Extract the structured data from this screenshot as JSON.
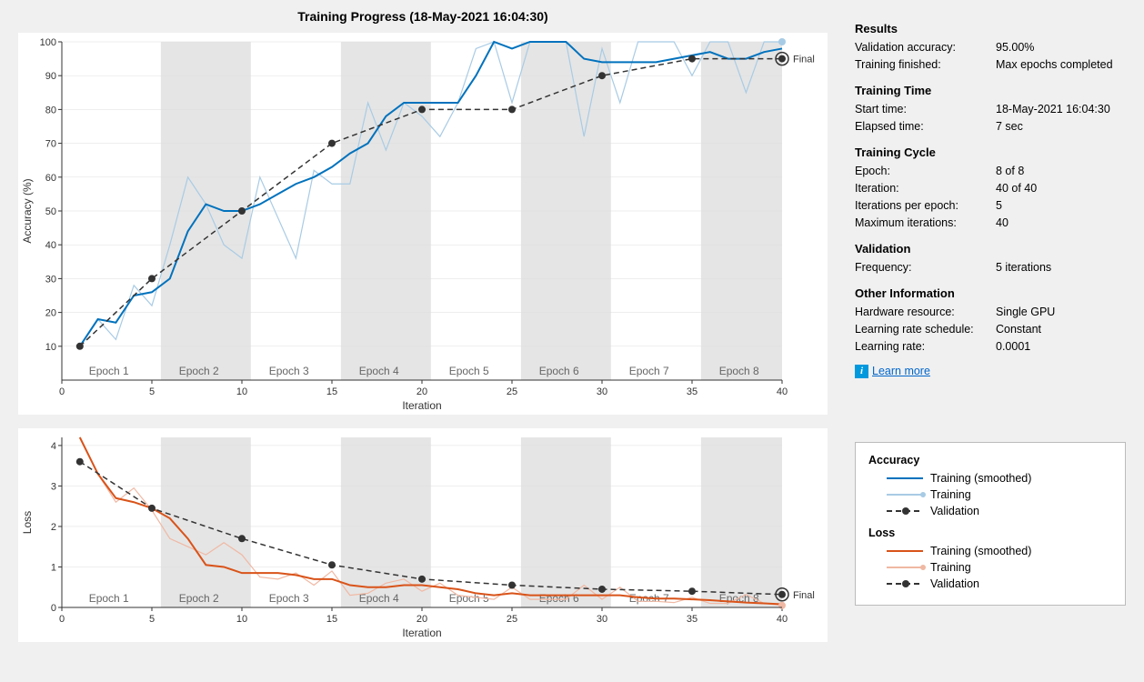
{
  "title": "Training Progress (18-May-2021 16:04:30)",
  "info": {
    "results": {
      "head": "Results",
      "valacc_l": "Validation accuracy:",
      "valacc_v": "95.00%",
      "fin_l": "Training finished:",
      "fin_v": "Max epochs completed"
    },
    "time": {
      "head": "Training Time",
      "start_l": "Start time:",
      "start_v": "18-May-2021 16:04:30",
      "elapsed_l": "Elapsed time:",
      "elapsed_v": "7 sec"
    },
    "cycle": {
      "head": "Training Cycle",
      "epoch_l": "Epoch:",
      "epoch_v": "8 of 8",
      "iter_l": "Iteration:",
      "iter_v": "40 of 40",
      "ipe_l": "Iterations per epoch:",
      "ipe_v": "5",
      "maxit_l": "Maximum iterations:",
      "maxit_v": "40"
    },
    "validation": {
      "head": "Validation",
      "freq_l": "Frequency:",
      "freq_v": "5 iterations"
    },
    "other": {
      "head": "Other Information",
      "hw_l": "Hardware resource:",
      "hw_v": "Single GPU",
      "lrs_l": "Learning rate schedule:",
      "lrs_v": "Constant",
      "lr_l": "Learning rate:",
      "lr_v": "0.0001"
    },
    "learn_more": "Learn more"
  },
  "legend": {
    "acc_head": "Accuracy",
    "loss_head": "Loss",
    "train_smooth": "Training (smoothed)",
    "train": "Training",
    "validation": "Validation"
  },
  "axes": {
    "acc_ylabel": "Accuracy (%)",
    "loss_ylabel": "Loss",
    "xlabel": "Iteration",
    "final_label": "Final"
  },
  "epochs": [
    "Epoch 1",
    "Epoch 2",
    "Epoch 3",
    "Epoch 4",
    "Epoch 5",
    "Epoch 6",
    "Epoch 7",
    "Epoch 8"
  ],
  "chart_data": [
    {
      "type": "line",
      "title": "Accuracy (%)",
      "xlabel": "Iteration",
      "ylabel": "Accuracy (%)",
      "xlim": [
        0,
        40
      ],
      "ylim": [
        0,
        100
      ],
      "xticks": [
        0,
        5,
        10,
        15,
        20,
        25,
        30,
        35,
        40
      ],
      "yticks": [
        10,
        20,
        30,
        40,
        50,
        60,
        70,
        80,
        90,
        100
      ],
      "epoch_bands": [
        [
          1,
          5
        ],
        [
          6,
          10
        ],
        [
          11,
          15
        ],
        [
          16,
          20
        ],
        [
          21,
          25
        ],
        [
          26,
          30
        ],
        [
          31,
          35
        ],
        [
          36,
          40
        ]
      ],
      "series": [
        {
          "name": "Training (smoothed)",
          "color": "#0072bd",
          "x": [
            1,
            2,
            3,
            4,
            5,
            6,
            7,
            8,
            9,
            10,
            11,
            12,
            13,
            14,
            15,
            16,
            17,
            18,
            19,
            20,
            21,
            22,
            23,
            24,
            25,
            26,
            27,
            28,
            29,
            30,
            31,
            32,
            33,
            34,
            35,
            36,
            37,
            38,
            39,
            40
          ],
          "y": [
            10,
            18,
            17,
            25,
            26,
            30,
            44,
            52,
            50,
            50,
            52,
            55,
            58,
            60,
            63,
            67,
            70,
            78,
            82,
            82,
            82,
            82,
            90,
            100,
            98,
            100,
            100,
            100,
            95,
            94,
            94,
            94,
            94,
            95,
            96,
            97,
            95,
            95,
            97,
            98
          ]
        },
        {
          "name": "Training",
          "color": "#a8cbe5",
          "x": [
            1,
            2,
            3,
            4,
            5,
            6,
            7,
            8,
            9,
            10,
            11,
            12,
            13,
            14,
            15,
            16,
            17,
            18,
            19,
            20,
            21,
            22,
            23,
            24,
            25,
            26,
            27,
            28,
            29,
            30,
            31,
            32,
            33,
            34,
            35,
            36,
            37,
            38,
            39,
            40
          ],
          "y": [
            10,
            18,
            12,
            28,
            22,
            40,
            60,
            52,
            40,
            36,
            60,
            48,
            36,
            62,
            58,
            58,
            82,
            68,
            82,
            78,
            72,
            82,
            98,
            100,
            82,
            100,
            100,
            100,
            72,
            98,
            82,
            100,
            100,
            100,
            90,
            100,
            100,
            85,
            100,
            100
          ]
        },
        {
          "name": "Validation",
          "color": "#333",
          "style": "dash",
          "marker": true,
          "x": [
            1,
            5,
            10,
            15,
            20,
            25,
            30,
            35,
            40
          ],
          "y": [
            10,
            30,
            50,
            70,
            80,
            80,
            90,
            95,
            95
          ]
        }
      ],
      "final_label": "Final"
    },
    {
      "type": "line",
      "title": "Loss",
      "xlabel": "Iteration",
      "ylabel": "Loss",
      "xlim": [
        0,
        40
      ],
      "ylim": [
        0,
        4.2
      ],
      "xticks": [
        0,
        5,
        10,
        15,
        20,
        25,
        30,
        35,
        40
      ],
      "yticks": [
        0,
        1,
        2,
        3,
        4
      ],
      "epoch_bands": [
        [
          1,
          5
        ],
        [
          6,
          10
        ],
        [
          11,
          15
        ],
        [
          16,
          20
        ],
        [
          21,
          25
        ],
        [
          26,
          30
        ],
        [
          31,
          35
        ],
        [
          36,
          40
        ]
      ],
      "series": [
        {
          "name": "Training (smoothed)",
          "color": "#d95319",
          "x": [
            1,
            2,
            3,
            4,
            5,
            6,
            7,
            8,
            9,
            10,
            11,
            12,
            13,
            14,
            15,
            16,
            17,
            18,
            19,
            20,
            21,
            22,
            23,
            24,
            25,
            26,
            27,
            28,
            29,
            30,
            31,
            32,
            33,
            34,
            35,
            36,
            37,
            38,
            39,
            40
          ],
          "y": [
            4.2,
            3.3,
            2.7,
            2.6,
            2.45,
            2.2,
            1.7,
            1.05,
            1.0,
            0.85,
            0.85,
            0.85,
            0.8,
            0.7,
            0.7,
            0.55,
            0.5,
            0.5,
            0.55,
            0.55,
            0.5,
            0.45,
            0.35,
            0.3,
            0.35,
            0.3,
            0.3,
            0.3,
            0.3,
            0.3,
            0.3,
            0.25,
            0.22,
            0.22,
            0.2,
            0.18,
            0.15,
            0.12,
            0.1,
            0.08
          ]
        },
        {
          "name": "Training",
          "color": "#f0b8a3",
          "x": [
            1,
            2,
            3,
            4,
            5,
            6,
            7,
            8,
            9,
            10,
            11,
            12,
            13,
            14,
            15,
            16,
            17,
            18,
            19,
            20,
            21,
            22,
            23,
            24,
            25,
            26,
            27,
            28,
            29,
            30,
            31,
            32,
            33,
            34,
            35,
            36,
            37,
            38,
            39,
            40
          ],
          "y": [
            4.2,
            3.3,
            2.6,
            2.95,
            2.4,
            1.7,
            1.5,
            1.3,
            1.6,
            1.3,
            0.75,
            0.7,
            0.85,
            0.55,
            0.9,
            0.3,
            0.35,
            0.6,
            0.7,
            0.4,
            0.6,
            0.3,
            0.25,
            0.2,
            0.5,
            0.2,
            0.2,
            0.2,
            0.55,
            0.2,
            0.5,
            0.15,
            0.15,
            0.12,
            0.25,
            0.1,
            0.1,
            0.32,
            0.1,
            0.05
          ]
        },
        {
          "name": "Validation",
          "color": "#333",
          "style": "dash",
          "marker": true,
          "x": [
            1,
            5,
            10,
            15,
            20,
            25,
            30,
            35,
            40
          ],
          "y": [
            3.6,
            2.45,
            1.7,
            1.05,
            0.7,
            0.55,
            0.45,
            0.4,
            0.32
          ]
        }
      ],
      "final_label": "Final"
    }
  ]
}
